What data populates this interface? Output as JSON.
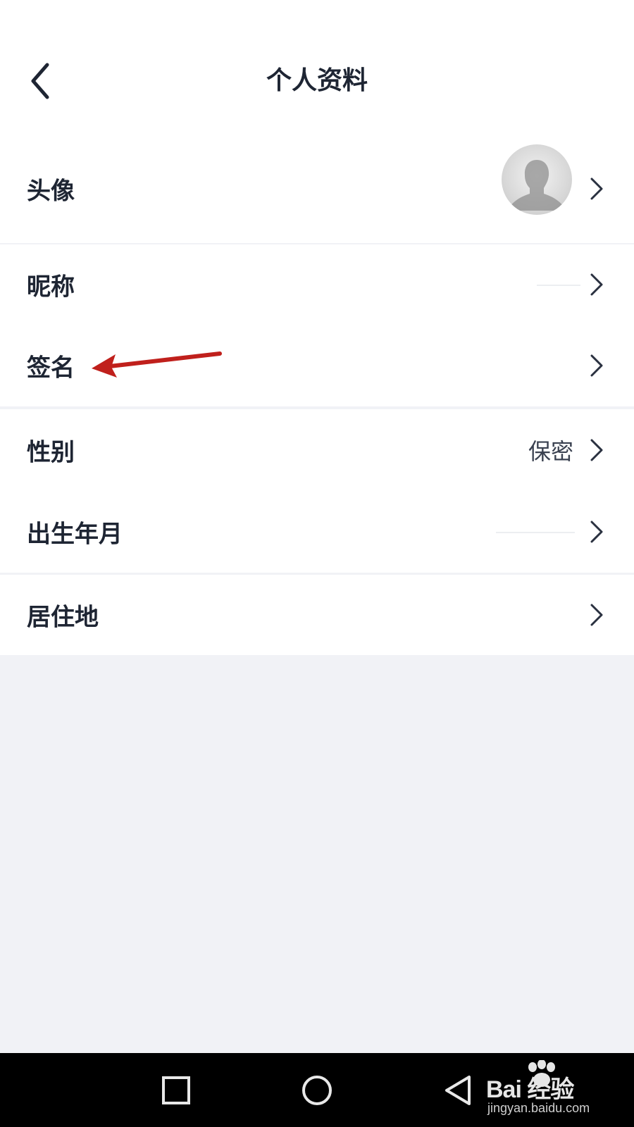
{
  "header": {
    "title": "个人资料"
  },
  "rows": [
    {
      "label": "头像"
    },
    {
      "label": "昵称",
      "value": ""
    },
    {
      "label": "签名",
      "value": ""
    },
    {
      "label": "性别",
      "value": "保密"
    },
    {
      "label": "出生年月",
      "value": ""
    },
    {
      "label": "居住地",
      "value": ""
    }
  ],
  "icons": {
    "back": "chevron-left-icon",
    "row_chevron": "chevron-right-icon",
    "annotation": "red-arrow-icon",
    "nav_recent": "square-icon",
    "nav_home": "circle-icon",
    "nav_back": "triangle-back-icon"
  },
  "watermark": {
    "logo_text": "Bai  经验",
    "url": "jingyan.baidu.com"
  },
  "colors": {
    "text": "#1e2533",
    "background": "#f1f2f6",
    "annotation": "#c0201c",
    "navbar": "#000000"
  }
}
